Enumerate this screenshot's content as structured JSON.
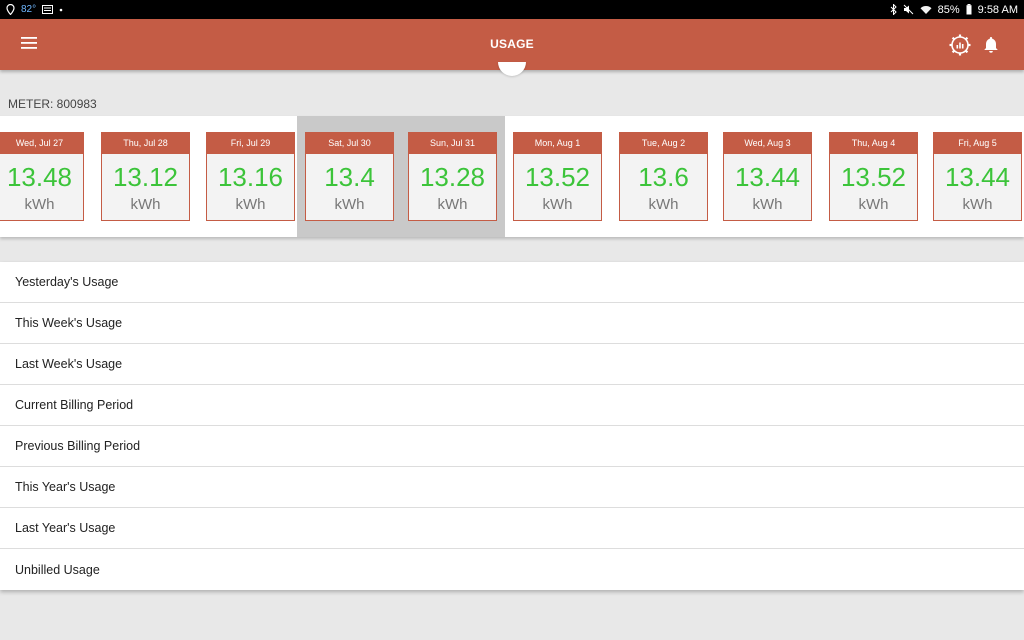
{
  "status_bar": {
    "temperature": "82°",
    "battery": "85%",
    "time": "9:58 AM"
  },
  "app_bar": {
    "title": "USAGE"
  },
  "meter_label": "METER: 800983",
  "days": [
    {
      "day": "Wed, Jul 27",
      "value": "13.48",
      "unit": "kWh",
      "weekend": false
    },
    {
      "day": "Thu, Jul 28",
      "value": "13.12",
      "unit": "kWh",
      "weekend": false
    },
    {
      "day": "Fri, Jul 29",
      "value": "13.16",
      "unit": "kWh",
      "weekend": false
    },
    {
      "day": "Sat, Jul 30",
      "value": "13.4",
      "unit": "kWh",
      "weekend": true
    },
    {
      "day": "Sun, Jul 31",
      "value": "13.28",
      "unit": "kWh",
      "weekend": true
    },
    {
      "day": "Mon, Aug 1",
      "value": "13.52",
      "unit": "kWh",
      "weekend": false
    },
    {
      "day": "Tue, Aug 2",
      "value": "13.6",
      "unit": "kWh",
      "weekend": false
    },
    {
      "day": "Wed, Aug 3",
      "value": "13.44",
      "unit": "kWh",
      "weekend": false
    },
    {
      "day": "Thu, Aug 4",
      "value": "13.52",
      "unit": "kWh",
      "weekend": false
    },
    {
      "day": "Fri, Aug 5",
      "value": "13.44",
      "unit": "kWh",
      "weekend": false
    }
  ],
  "usage_options": [
    "Yesterday's Usage",
    "This Week's Usage",
    "Last Week's Usage",
    "Current Billing Period",
    "Previous Billing Period",
    "This Year's Usage",
    "Last Year's Usage",
    "Unbilled Usage"
  ],
  "colors": {
    "brand": "#c45c45",
    "value_green": "#3cc43a",
    "weekend_bg": "#c9c9c9"
  },
  "icons": {
    "menu": "hamburger-icon",
    "settings": "gear-chart-icon",
    "notifications": "bell-icon"
  }
}
